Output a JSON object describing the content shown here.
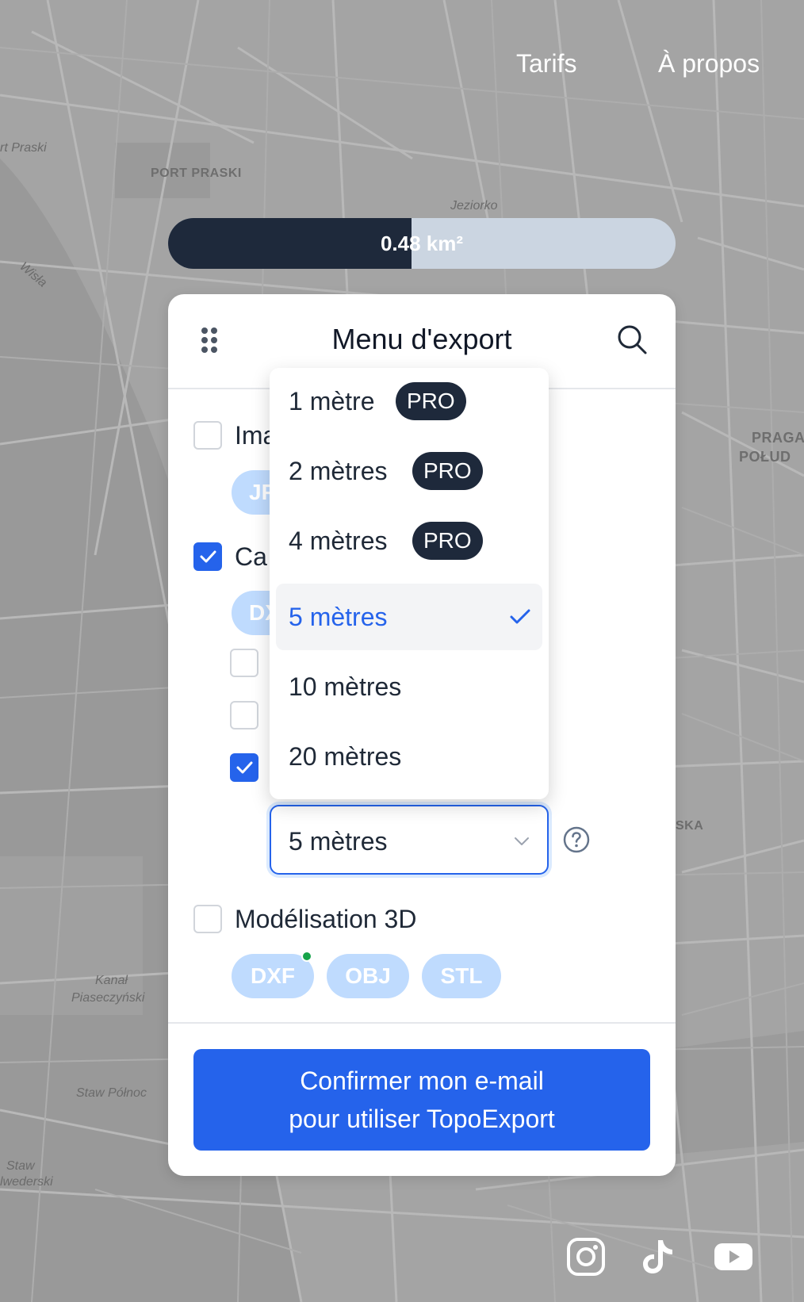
{
  "nav": {
    "tarifs": "Tarifs",
    "apropos": "À propos"
  },
  "map_labels": {
    "port_praski_italic": "rt Praski",
    "port_praski": "PORT PRASKI",
    "jeziorko": "Jeziorko",
    "wisla": "Wisła",
    "praga_1": "PRAGA",
    "praga_2": "POŁUD",
    "ska": "SKA",
    "kanal_1": "Kanał",
    "kanal_2": "Piaseczyński",
    "staw_polnoc": "Staw Północ",
    "staw_1": "Staw",
    "staw_2": "lwederski"
  },
  "area": {
    "text": "0.48 km²",
    "fill_fraction": 0.48
  },
  "panel": {
    "title": "Menu d'export",
    "options": {
      "images_label": "Ima",
      "images_chip": "JP",
      "cartes_label": "Ca",
      "cartes_chip": "DX",
      "modelisation_label": "Modélisation 3D"
    },
    "modelisation_chips": [
      "DXF",
      "OBJ",
      "STL"
    ],
    "select_value": "5 mètres",
    "confirm_line1": "Confirmer mon e-mail",
    "confirm_line2": "pour utiliser TopoExport"
  },
  "dropdown": {
    "pro_label": "PRO",
    "items": [
      {
        "label": "1 mètre",
        "pro": true
      },
      {
        "label": "2 mètres",
        "pro": true
      },
      {
        "label": "4 mètres",
        "pro": true
      },
      {
        "label": "5 mètres",
        "pro": false,
        "selected": true
      },
      {
        "label": "10 mètres",
        "pro": false
      },
      {
        "label": "20 mètres",
        "pro": false
      }
    ]
  },
  "colors": {
    "primary": "#2563eb",
    "dark": "#1e293b",
    "chip": "#bfdbfe",
    "map": "#a3a3a3"
  },
  "icons": [
    "drag-handle-icon",
    "search-icon",
    "check-icon",
    "chevron-down-icon",
    "help-icon",
    "instagram-icon",
    "tiktok-icon",
    "youtube-icon"
  ]
}
